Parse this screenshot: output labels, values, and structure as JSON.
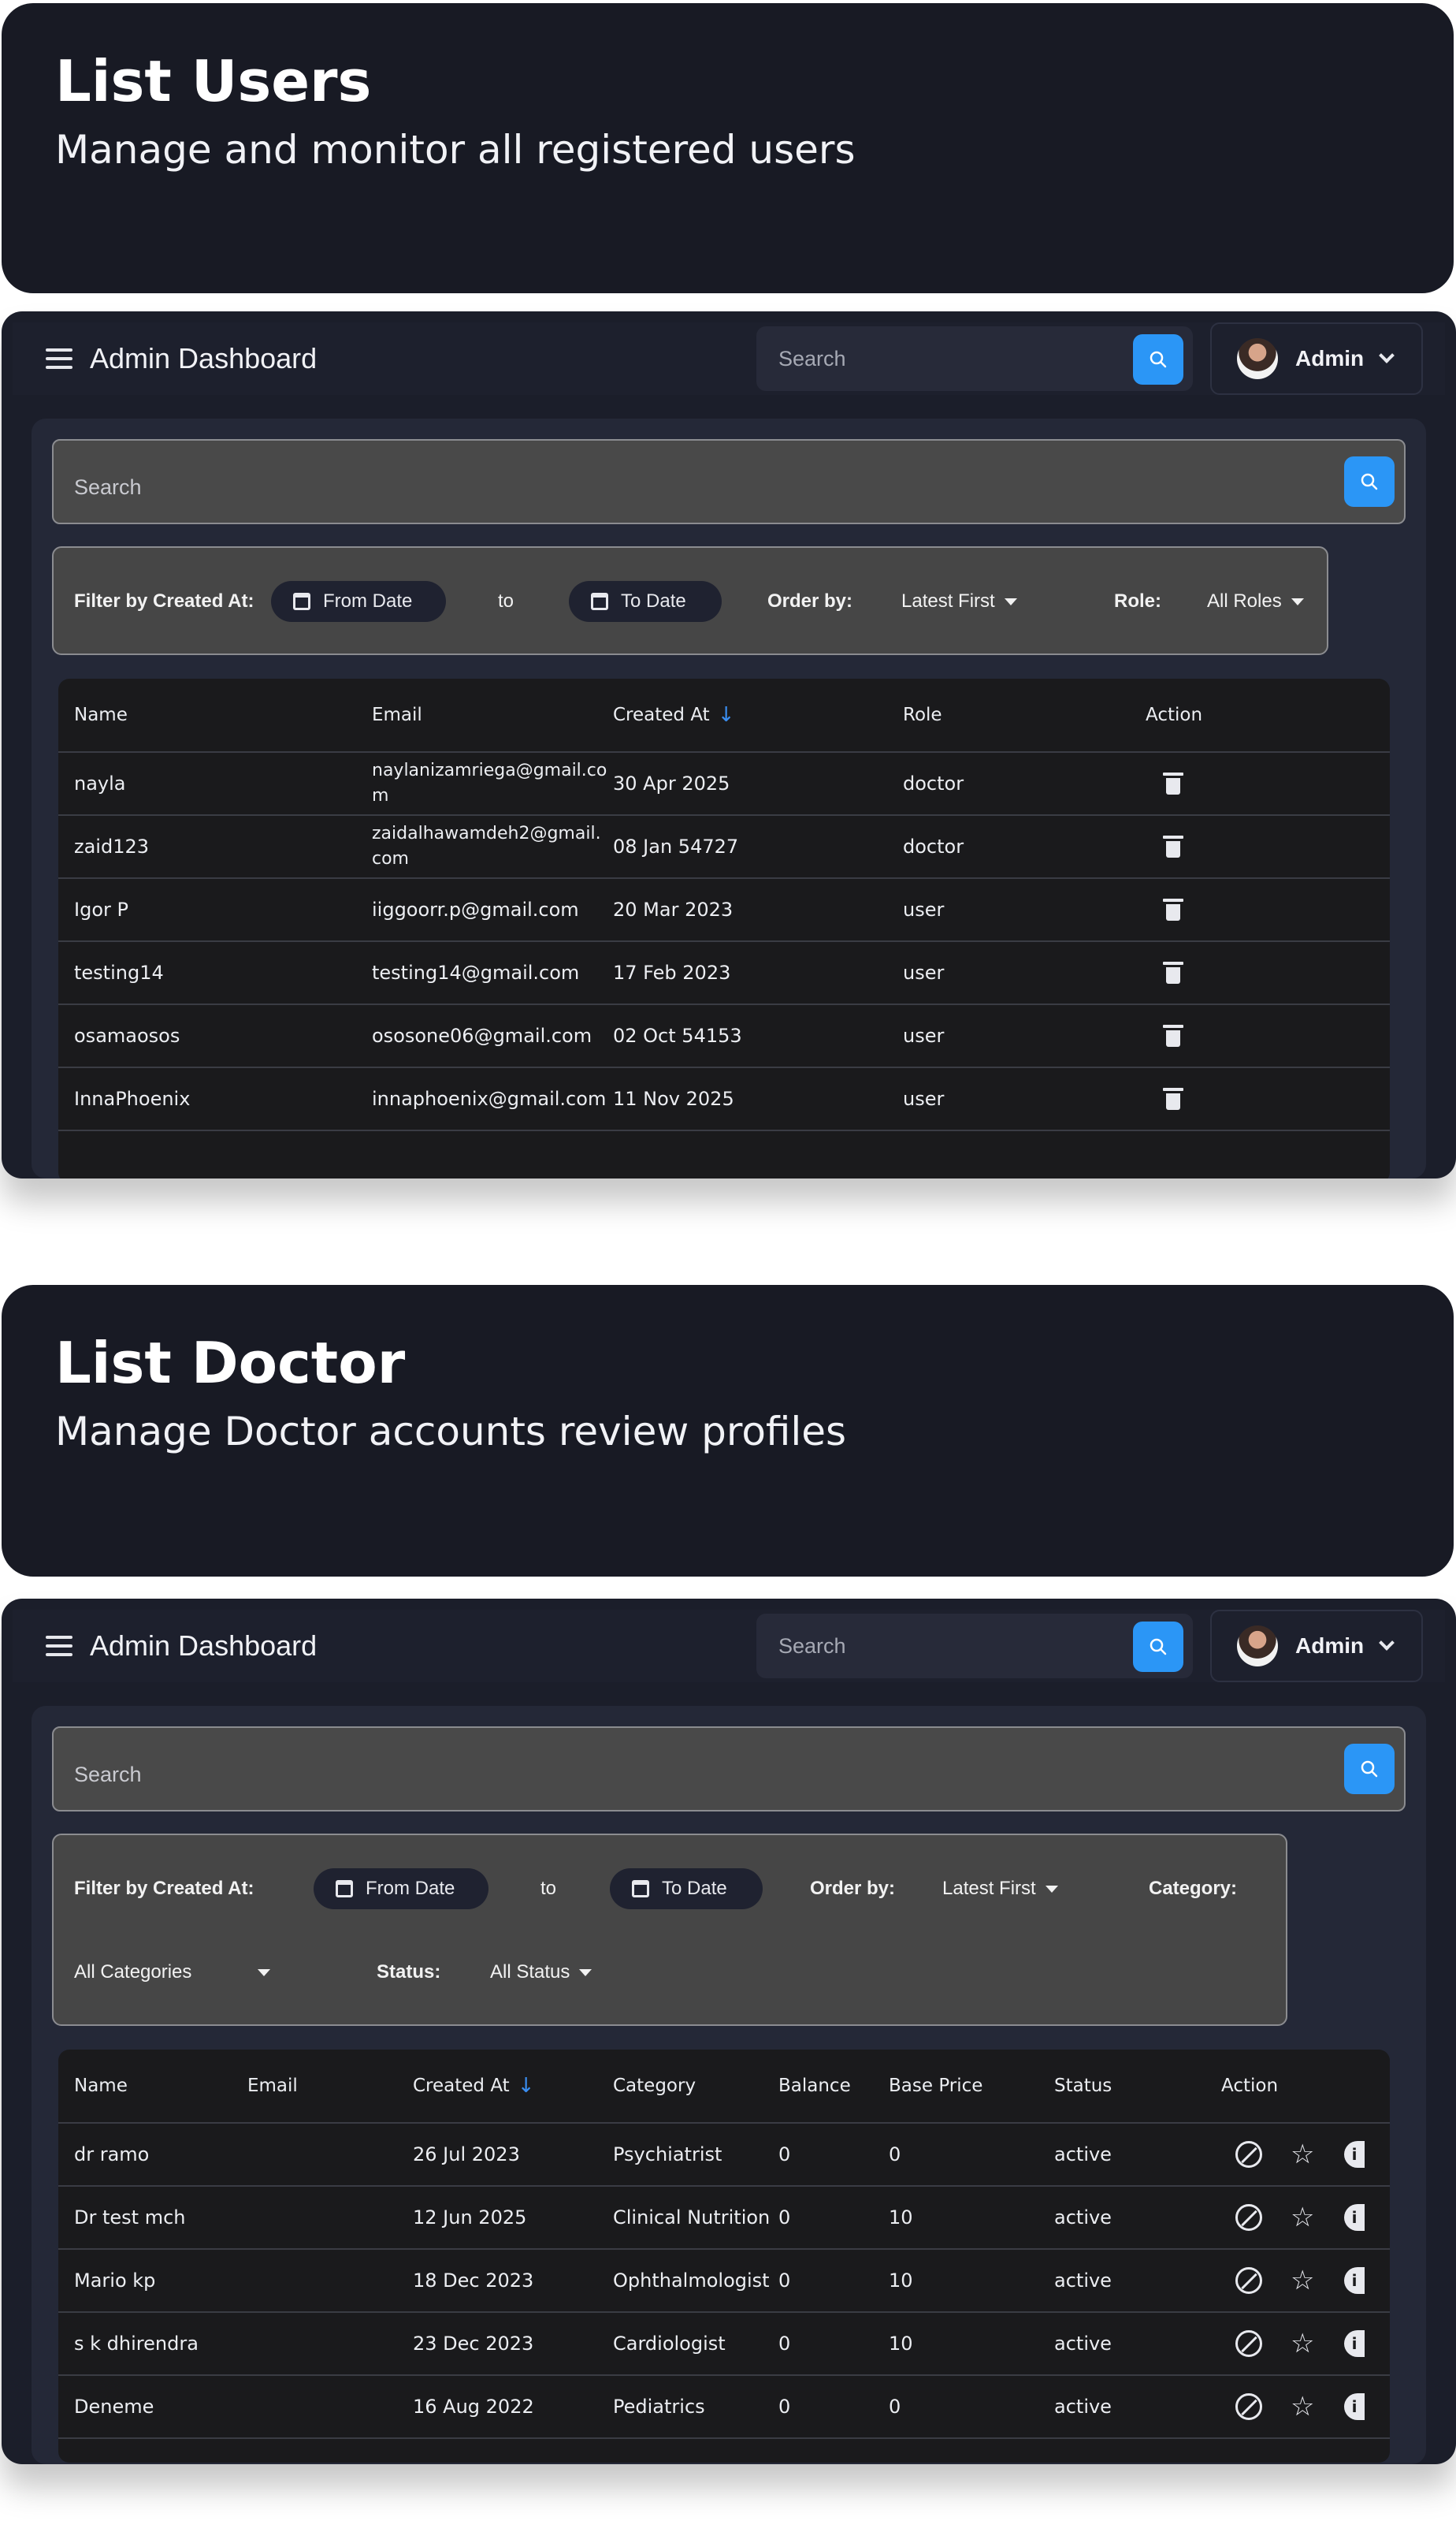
{
  "sections": [
    {
      "title": "List Users",
      "subtitle": "Manage and monitor all registered users",
      "dashboard": {
        "brand": "Admin Dashboard",
        "top_search_placeholder": "Search",
        "profile_name": "Admin",
        "main_search_placeholder": "Search",
        "filters": {
          "filter_label": "Filter by Created At:",
          "from_date": "From Date",
          "to_label": "to",
          "to_date": "To Date",
          "order_label": "Order by:",
          "order_value": "Latest First",
          "role_label": "Role:",
          "role_value": "All Roles"
        },
        "columns": [
          "Name",
          "Email",
          "Created At",
          "Role",
          "Action"
        ],
        "rows": [
          {
            "name": "nayla",
            "email": "naylanizamriega@gmail.com",
            "created": "30 Apr 2025",
            "role": "doctor"
          },
          {
            "name": "zaid123",
            "email": "zaidalhawamdeh2@gmail.com",
            "created": "08 Jan 54727",
            "role": "doctor"
          },
          {
            "name": "Igor P",
            "email": "iiggoorr.p@gmail.com",
            "created": "20 Mar 2023",
            "role": "user"
          },
          {
            "name": "testing14",
            "email": "testing14@gmail.com",
            "created": "17 Feb 2023",
            "role": "user"
          },
          {
            "name": "osamaosos",
            "email": "ososone06@gmail.com",
            "created": "02 Oct 54153",
            "role": "user"
          },
          {
            "name": "InnaPhoenix",
            "email": "innaphoenix@gmail.com",
            "created": "11 Nov 2025",
            "role": "user"
          }
        ]
      }
    },
    {
      "title": "List Doctor",
      "subtitle": "Manage Doctor accounts review profiles",
      "dashboard": {
        "brand": "Admin Dashboard",
        "top_search_placeholder": "Search",
        "profile_name": "Admin",
        "main_search_placeholder": "Search",
        "filters": {
          "filter_label": "Filter by Created At:",
          "from_date": "From Date",
          "to_label": "to",
          "to_date": "To Date",
          "order_label": "Order by:",
          "order_value": "Latest First",
          "category_label": "Category:",
          "category_value": "All Categories",
          "status_label": "Status:",
          "status_value": "All Status"
        },
        "columns": [
          "Name",
          "Email",
          "Created At",
          "Category",
          "Balance",
          "Base Price",
          "Status",
          "Action"
        ],
        "rows": [
          {
            "name": "dr ramo",
            "email": "",
            "created": "26 Jul 2023",
            "category": "Psychiatrist",
            "balance": "0",
            "base_price": "0",
            "status": "active"
          },
          {
            "name": "Dr test mch",
            "email": "",
            "created": "12 Jun 2025",
            "category": "Clinical Nutrition",
            "balance": "0",
            "base_price": "10",
            "status": "active"
          },
          {
            "name": "Mario kp",
            "email": "",
            "created": "18 Dec 2023",
            "category": "Ophthalmologist",
            "balance": "0",
            "base_price": "10",
            "status": "active"
          },
          {
            "name": "s k dhirendra",
            "email": "",
            "created": "23 Dec 2023",
            "category": "Cardiologist",
            "balance": "0",
            "base_price": "10",
            "status": "active"
          },
          {
            "name": "Deneme",
            "email": "",
            "created": "16 Aug 2022",
            "category": "Pediatrics",
            "balance": "0",
            "base_price": "0",
            "status": "active"
          }
        ]
      }
    }
  ],
  "icons": {
    "menu": "menu-icon",
    "search": "search-icon",
    "avatar": "avatar",
    "chevron": "chevron-down-icon",
    "calendar": "calendar-icon",
    "sort": "arrow-down-icon",
    "delete": "trash-icon",
    "block": "ban-icon",
    "favorite": "star-icon",
    "info": "info-icon"
  },
  "colors": {
    "accent": "#2b96f6",
    "banner_bg": "#181a24",
    "panel_bg": "#242837",
    "table_bg": "#1a1a1c"
  }
}
